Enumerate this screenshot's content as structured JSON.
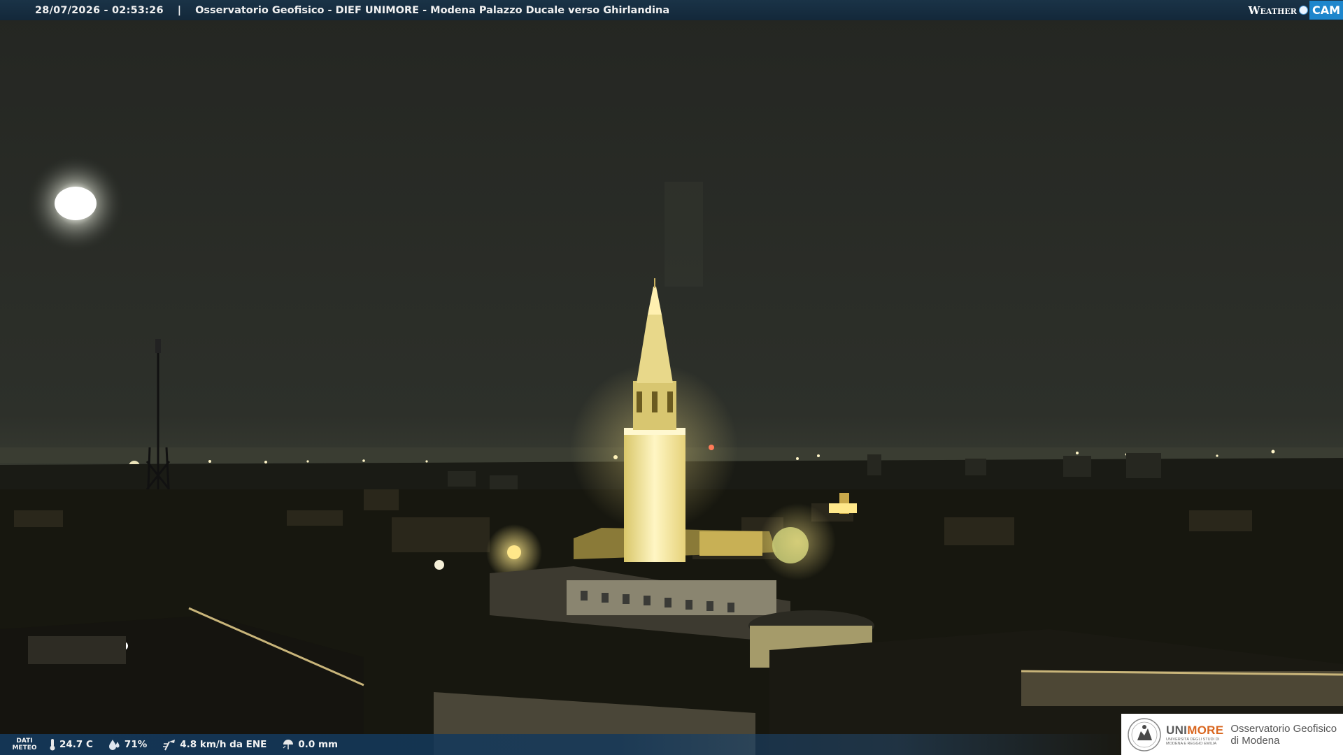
{
  "overlay": {
    "timestamp": "28/07/2026 - 02:53:26",
    "separator": "|",
    "title": "Osservatorio Geofisico - DIEF UNIMORE - Modena Palazzo Ducale verso Ghirlandina",
    "logo": {
      "weather": "Weather",
      "cam": "CAM"
    }
  },
  "weather_bar": {
    "label_line1": "DATI",
    "label_line2": "METEO",
    "temperature": "24.7 C",
    "humidity": "71%",
    "wind": "4.8 km/h da ENE",
    "rain": "0.0 mm",
    "icons": [
      "thermometer-icon",
      "humidity-drop-icon",
      "wind-icon",
      "rain-umbrella-icon"
    ]
  },
  "institution": {
    "brand_gray": "UNI",
    "brand_orange": "MORE",
    "brand_sub_line1": "UNIVERSITÀ DEGLI STUDI DI",
    "brand_sub_line2": "MODENA E REGGIO EMILIA",
    "name_line1": "Osservatorio Geofisico",
    "name_line2": "di Modena"
  },
  "colors": {
    "top_bar": "#13283a",
    "bottom_bar": "#14385a",
    "unimore_orange": "#d9661f",
    "sky": "#2a2d28",
    "tower_light": "#fff2b0"
  }
}
